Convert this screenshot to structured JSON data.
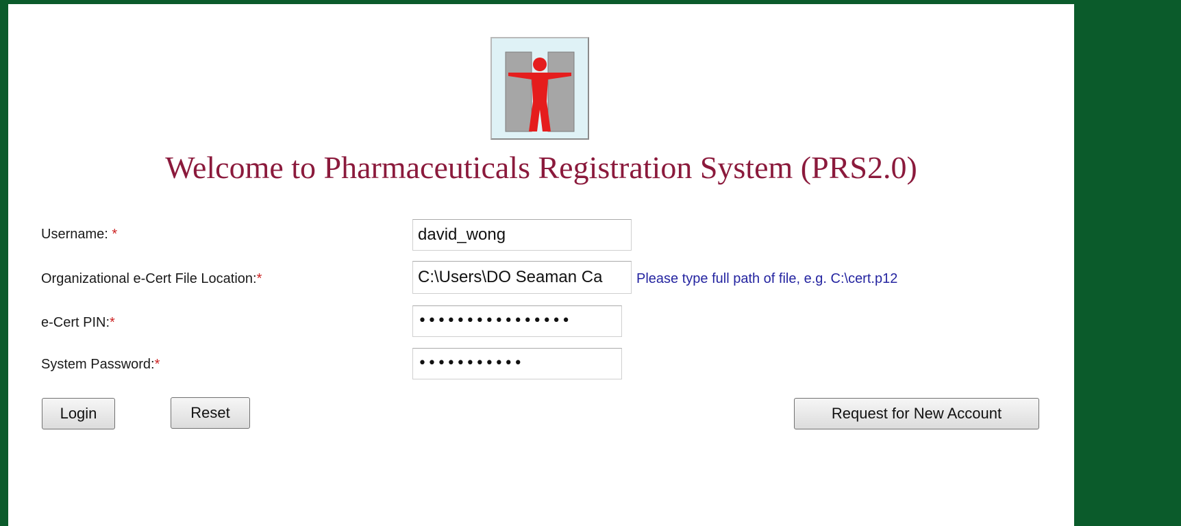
{
  "page": {
    "title": "Welcome to Pharmaceuticals Registration System (PRS2.0)"
  },
  "logo": {
    "icon": "human-figure-logo-icon",
    "colors": {
      "figure": "#e51d1d",
      "pillars": "#a8a8a8",
      "background": "#dff2f6"
    }
  },
  "form": {
    "username": {
      "label": "Username: ",
      "required_mark": "*",
      "value": "david_wong"
    },
    "cert_location": {
      "label": "Organizational e-Cert File Location:",
      "required_mark": "*",
      "value": "C:\\Users\\DO Seaman Ca",
      "hint": "Please type full path of file, e.g. C:\\cert.p12"
    },
    "cert_pin": {
      "label": "e-Cert PIN:",
      "required_mark": "*",
      "value": "••••••••••••••••"
    },
    "system_password": {
      "label": "System Password:",
      "required_mark": "*",
      "value": "•••••••••••"
    }
  },
  "buttons": {
    "login": "Login",
    "reset": "Reset",
    "request_account": "Request for New Account"
  },
  "colors": {
    "frame": "#0b5b2b",
    "title": "#8b1a3c",
    "required": "#cc2222",
    "hint": "#2424a0"
  }
}
